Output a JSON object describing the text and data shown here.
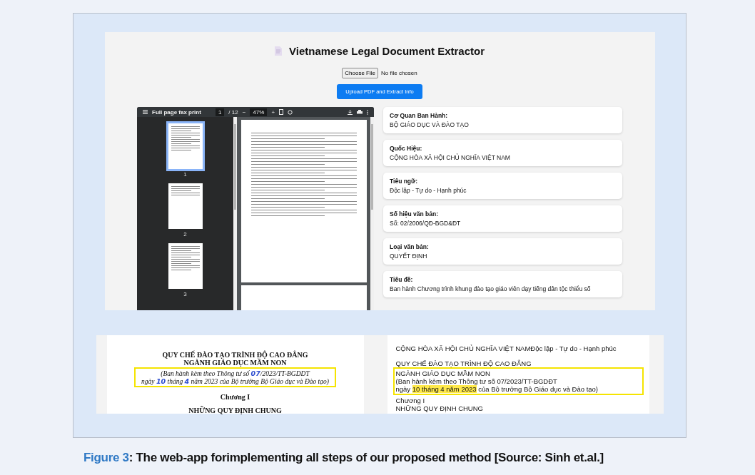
{
  "app": {
    "title": "Vietnamese Legal Document Extractor",
    "file_button": "Choose File",
    "file_status": "No file chosen",
    "upload_button": "Upload PDF and Extract Info"
  },
  "pdf_viewer": {
    "document_title": "Full page fax print",
    "page_number": "1",
    "page_total": "/ 12",
    "zoom": "47%",
    "zoom_out": "−",
    "zoom_in": "+",
    "thumbnails": [
      {
        "label": "1",
        "selected": true
      },
      {
        "label": "2",
        "selected": false
      },
      {
        "label": "3",
        "selected": false
      }
    ]
  },
  "fields": [
    {
      "label": "Cơ Quan Ban Hành:",
      "value": "BỘ GIÁO DỤC VÀ ĐÀO TẠO"
    },
    {
      "label": "Quốc Hiệu:",
      "value": "CỘNG HÒA XÃ HỘI CHỦ NGHĨA VIỆT NAM"
    },
    {
      "label": "Tiêu ngữ:",
      "value": "Độc lập - Tự do - Hạnh phúc"
    },
    {
      "label": "Số hiệu văn bản:",
      "value": "Số: 02/2006/QĐ-BGD&ĐT"
    },
    {
      "label": "Loại văn bản:",
      "value": "QUYẾT ĐỊNH"
    },
    {
      "label": "Tiêu đề:",
      "value": "Ban hành Chương trình khung đào tạo giáo viên dạy tiếng dân tộc thiểu số"
    }
  ],
  "scan_excerpt": {
    "heading": [
      "QUY CHẾ ĐÀO TẠO TRÌNH ĐỘ CAO ĐẲNG",
      "NGÀNH GIÁO DỤC MẦM NON"
    ],
    "boxed_lines": [
      [
        {
          "text": "(Ban hành kèm theo Thông tư số ",
          "handwritten": false
        },
        {
          "text": "07",
          "handwritten": true
        },
        {
          "text": "/2023/TT-BGDDT",
          "handwritten": false
        }
      ],
      [
        {
          "text": "ngày ",
          "handwritten": false
        },
        {
          "text": "10",
          "handwritten": true
        },
        {
          "text": " tháng ",
          "handwritten": false
        },
        {
          "text": "4",
          "handwritten": true
        },
        {
          "text": " năm 2023 của Bộ trưởng Bộ Giáo dục và Đào tạo)",
          "handwritten": false
        }
      ]
    ],
    "after": [
      "Chương I",
      "NHỮNG QUY ĐỊNH CHUNG"
    ]
  },
  "extracted_text": {
    "before": [
      "CỘNG HÒA XÃ HỘI CHỦ NGHĨA VIỆT NAMĐộc lập - Tự do - Hạnh phúc",
      "QUY CHẾ ĐÀO TẠO TRÌNH ĐỘ CAO ĐẲNG"
    ],
    "boxed_lines": [
      [
        {
          "text": "NGÀNH GIÁO DỤC MẦM NON",
          "highlighted": false
        }
      ],
      [
        {
          "text": "(Ban hành kèm theo Thông tư số 07/2023/TT-BGDĐT",
          "highlighted": false
        }
      ],
      [
        {
          "text": "ngày ",
          "highlighted": false
        },
        {
          "text": "10 tháng 4 năm 2023",
          "highlighted": true
        },
        {
          "text": " của Bộ trưởng Bộ Giáo dục và Đào tạo)",
          "highlighted": false
        }
      ]
    ],
    "after": [
      "Chương I",
      "NHỮNG QUY ĐỊNH CHUNG"
    ]
  },
  "caption": {
    "label": "Figure 3",
    "text": ": The web-app forimplementing all steps of our proposed method [Source: Sinh et.al.]"
  }
}
